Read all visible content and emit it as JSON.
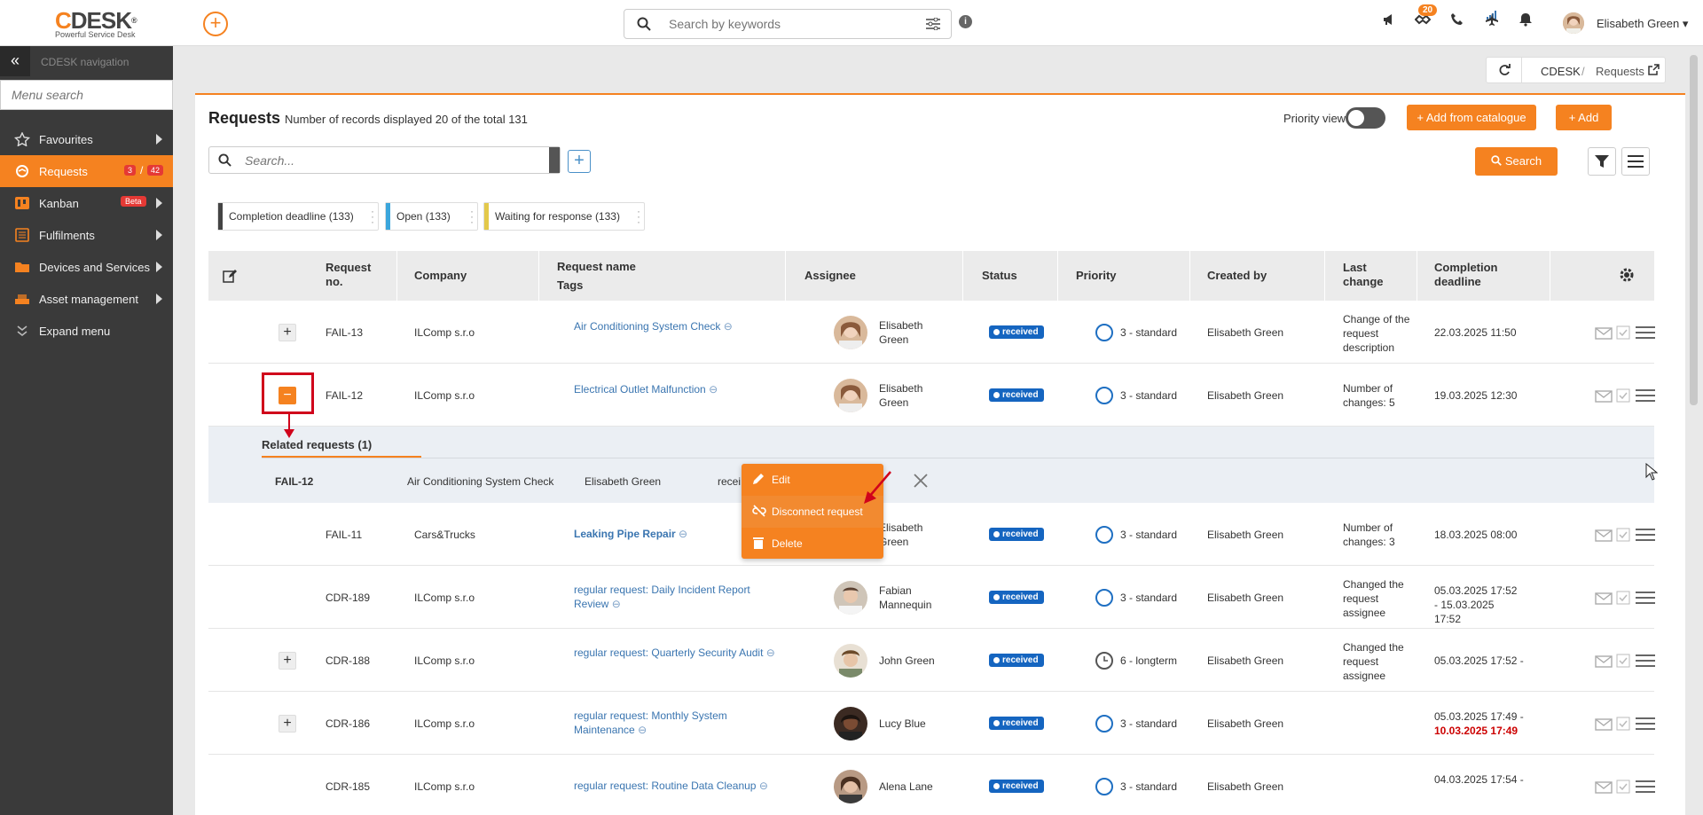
{
  "topbar": {
    "logo_text": "DESK",
    "logo_letter": "C",
    "logo_reg": "®",
    "logo_tagline": "Powerful Service Desk",
    "search_placeholder": "Search by keywords",
    "info_label": "i",
    "notification_count": "20",
    "user_name": "Elisabeth Green"
  },
  "sidebar": {
    "header_label": "CDESK navigation",
    "search_placeholder": "Menu search",
    "items": [
      {
        "label": "Favourites"
      },
      {
        "label": "Requests",
        "count_a": "3",
        "count_b": "42"
      },
      {
        "label": "Kanban",
        "badge": "Beta"
      },
      {
        "label": "Fulfilments"
      },
      {
        "label": "Devices and Services"
      },
      {
        "label": "Asset management"
      },
      {
        "label": "Expand menu"
      }
    ]
  },
  "breadcrumb": {
    "root": "CDESK",
    "separator": "/",
    "current": "Requests"
  },
  "page": {
    "title": "Requests",
    "subtitle": "Number of records displayed 20 of the total 131",
    "priority_view_label": "Priority view",
    "add_from_catalogue": "+ Add from catalogue",
    "add": "+ Add",
    "search_placeholder": "Search...",
    "search_button": "Search"
  },
  "chips": [
    {
      "label": "Completion deadline (133)",
      "color": "#444444"
    },
    {
      "label": "Open (133)",
      "color": "#3ba6dc"
    },
    {
      "label": "Waiting for response (133)",
      "color": "#e3c94a"
    }
  ],
  "columns": {
    "request_no": "Request no.",
    "company": "Company",
    "request_name": "Request name",
    "tags": "Tags",
    "assignee": "Assignee",
    "status": "Status",
    "priority": "Priority",
    "created_by": "Created by",
    "last_change": "Last change",
    "completion_deadline": "Completion deadline"
  },
  "rows": [
    {
      "no": "FAIL-13",
      "company": "ILComp s.r.o",
      "name": "Air Conditioning System Check",
      "assignee": "Elisabeth Green",
      "status": "received",
      "priority": "3 - standard",
      "created_by": "Elisabeth Green",
      "last_change": "Change of the request description",
      "deadline": "22.03.2025 11:50"
    },
    {
      "no": "FAIL-12",
      "company": "ILComp s.r.o",
      "name": "Electrical Outlet Malfunction",
      "assignee": "Elisabeth Green",
      "status": "received",
      "priority": "3 - standard",
      "created_by": "Elisabeth Green",
      "last_change": "Number of changes: 5",
      "deadline": "19.03.2025 12:30"
    },
    {
      "no": "FAIL-11",
      "company": "Cars&Trucks",
      "name": "Leaking Pipe Repair",
      "assignee": "Elisabeth Green",
      "status": "received",
      "priority": "3 - standard",
      "created_by": "Elisabeth Green",
      "last_change": "Number of changes: 3",
      "deadline": "18.03.2025 08:00"
    },
    {
      "no": "CDR-189",
      "company": "ILComp s.r.o",
      "name": "regular request: Daily Incident Report Review",
      "assignee": "Fabian Mannequin",
      "status": "received",
      "priority": "3 - standard",
      "created_by": "Elisabeth Green",
      "last_change": "Changed the request assignee",
      "deadline": "05.03.2025 17:52 - 15.03.2025 17:52"
    },
    {
      "no": "CDR-188",
      "company": "ILComp s.r.o",
      "name": "regular request: Quarterly Security Audit",
      "assignee": "John Green",
      "status": "received",
      "priority": "6 - longterm",
      "created_by": "Elisabeth Green",
      "last_change": "Changed the request assignee",
      "deadline": "05.03.2025 17:52 -"
    },
    {
      "no": "CDR-186",
      "company": "ILComp s.r.o",
      "name": "regular request: Monthly System Maintenance",
      "assignee": "Lucy Blue",
      "status": "received",
      "priority": "3 - standard",
      "created_by": "Elisabeth Green",
      "last_change": "",
      "deadline": "05.03.2025 17:49 -",
      "deadline_overdue": "10.03.2025 17:49"
    },
    {
      "no": "CDR-185",
      "company": "ILComp s.r.o",
      "name": "regular request: Routine Data Cleanup",
      "assignee": "Alena Lane",
      "status": "received",
      "priority": "3 - standard",
      "created_by": "Elisabeth Green",
      "last_change": "",
      "deadline": "04.03.2025 17:54 -"
    }
  ],
  "related": {
    "title": "Related requests (1)",
    "no": "FAIL-12",
    "name": "Air Conditioning System Check",
    "assignee": "Elisabeth Green",
    "status_partial": "recei"
  },
  "context_menu": {
    "edit": "Edit",
    "disconnect": "Disconnect request",
    "delete": "Delete"
  },
  "colors": {
    "accent": "#f58220",
    "status": "#1565c0",
    "link": "#3a75b0"
  }
}
